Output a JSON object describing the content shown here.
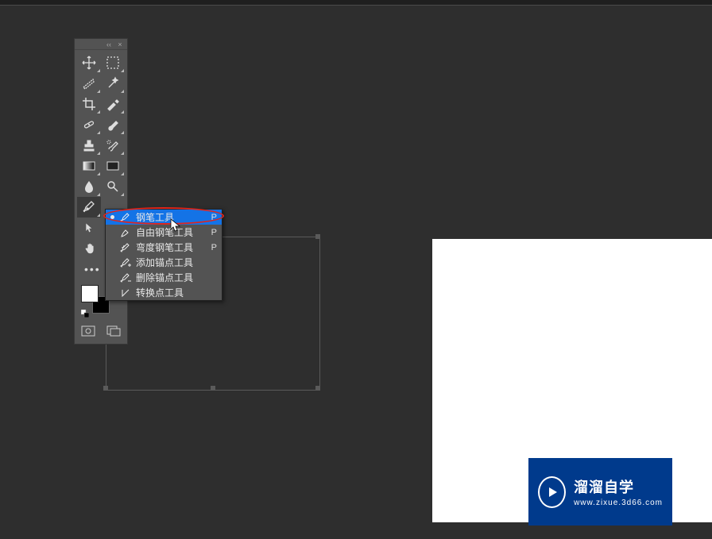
{
  "flyout": {
    "items": [
      {
        "label": "钢笔工具",
        "shortcut": "P"
      },
      {
        "label": "自由钢笔工具",
        "shortcut": "P"
      },
      {
        "label": "弯度钢笔工具",
        "shortcut": "P"
      },
      {
        "label": "添加锚点工具",
        "shortcut": ""
      },
      {
        "label": "删除锚点工具",
        "shortcut": ""
      },
      {
        "label": "转换点工具",
        "shortcut": ""
      }
    ]
  },
  "watermark": {
    "main": "溜溜自学",
    "sub": "www.zixue.3d66.com"
  }
}
